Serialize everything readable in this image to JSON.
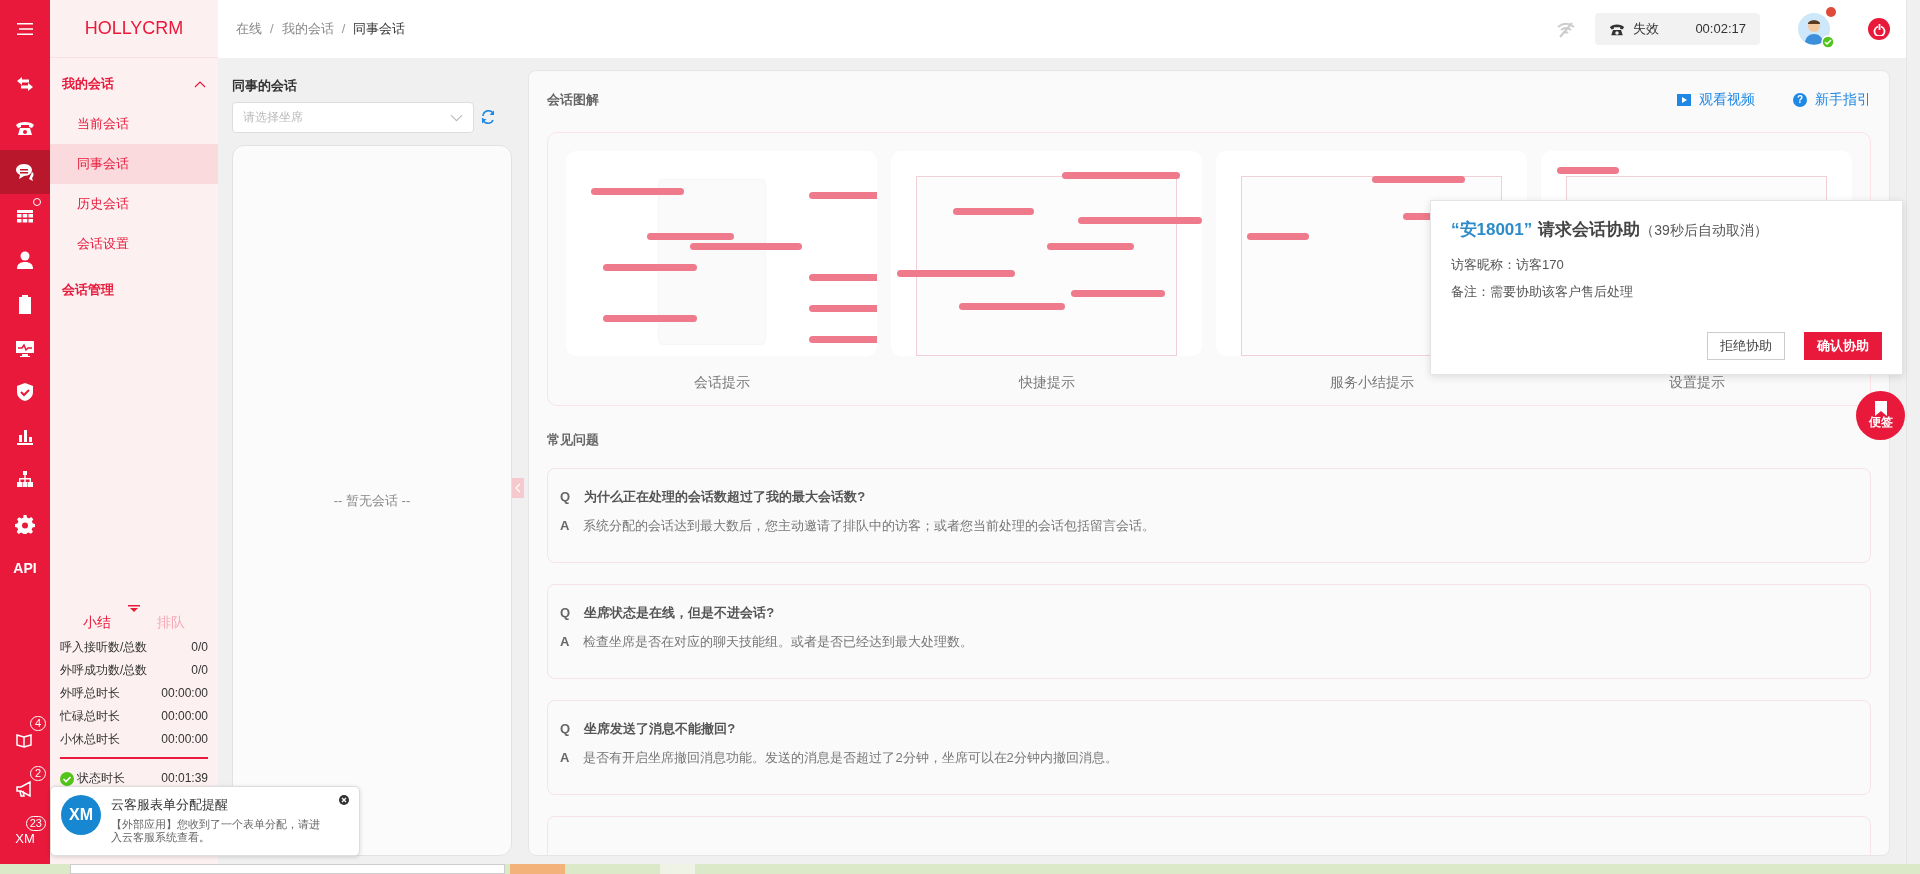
{
  "rail_items": [
    {
      "selected": false,
      "dot": false
    },
    {
      "selected": false,
      "dot": false
    },
    {
      "selected": true,
      "dot": false
    },
    {
      "selected": false,
      "dot": true
    },
    {
      "selected": false,
      "dot": false
    },
    {
      "selected": false,
      "dot": false
    },
    {
      "selected": false,
      "dot": false
    },
    {
      "selected": false,
      "dot": false
    },
    {
      "selected": false,
      "dot": false
    },
    {
      "selected": false,
      "dot": false
    },
    {
      "selected": false,
      "dot": false
    },
    {
      "selected": false,
      "dot": false,
      "label": "API"
    }
  ],
  "rail_bottom": [
    {
      "badge": "4"
    },
    {
      "badge": "2"
    },
    {
      "label": "XM",
      "badge": "23"
    }
  ],
  "brand": "HOLLYCRM",
  "nav": [
    {
      "label": "我的会话",
      "expanded": true,
      "children": [
        {
          "label": "当前会话",
          "selected": false
        },
        {
          "label": "同事会话",
          "selected": true
        },
        {
          "label": "历史会话",
          "selected": false
        },
        {
          "label": "会话设置",
          "selected": false
        }
      ]
    },
    {
      "label": "会话管理"
    }
  ],
  "stats": {
    "tabs": [
      {
        "label": "小结",
        "selected": true
      },
      {
        "label": "排队",
        "selected": false
      }
    ],
    "rows": [
      {
        "label": "呼入接听数/总数",
        "value": "0/0"
      },
      {
        "label": "外呼成功数/总数",
        "value": "0/0"
      },
      {
        "label": "外呼总时长",
        "value": "00:00:00"
      },
      {
        "label": "忙碌总时长",
        "value": "00:00:00"
      },
      {
        "label": "小休总时长",
        "value": "00:00:00"
      }
    ],
    "status": {
      "label": "状态时长",
      "value": "00:01:39"
    }
  },
  "breadcrumb": [
    {
      "kind": "link",
      "text": "在线"
    },
    {
      "kind": "separator",
      "text": "/"
    },
    {
      "kind": "link",
      "text": "我的会话"
    },
    {
      "kind": "separator",
      "text": "/"
    },
    {
      "kind": "current",
      "text": "同事会话"
    }
  ],
  "phone_status": {
    "label": "失效",
    "timer": "00:02:17"
  },
  "user": {
    "online": true,
    "unread_dot": true
  },
  "colleague": {
    "title": "同事的会话",
    "select_placeholder": "请选择坐席",
    "empty_text": "-- 暂无会话 --"
  },
  "guide": {
    "title": "会话图解",
    "links": [
      {
        "label": "观看视频"
      },
      {
        "label": "新手指引",
        "icon_text": "?"
      }
    ],
    "thumbnails": [
      "会话提示",
      "快捷提示",
      "服务小结提示",
      "设置提示"
    ]
  },
  "faq": {
    "title": "常见问题",
    "items": [
      {
        "q_label": "Q",
        "question": "为什么正在处理的会话数超过了我的最大会话数?",
        "a_label": "A",
        "answer": "系统分配的会话达到最大数后，您主动邀请了排队中的访客；或者您当前处理的会话包括留言会话。"
      },
      {
        "q_label": "Q",
        "question": "坐席状态是在线，但是不进会话?",
        "a_label": "A",
        "answer": "检查坐席是否在对应的聊天技能组。或者是否已经达到最大处理数。"
      },
      {
        "q_label": "Q",
        "question": "坐席发送了消息不能撤回?",
        "a_label": "A",
        "answer": "是否有开启坐席撤回消息功能。发送的消息是否超过了2分钟，坐席可以在2分钟内撤回消息。"
      }
    ]
  },
  "assist_popup": {
    "requester": "“安18001”",
    "title": "请求会话协助",
    "countdown": "（39秒后自动取消）",
    "lines": [
      "访客昵称：访客170",
      "备注：需要协助该客户售后处理"
    ],
    "buttons": [
      {
        "label": "拒绝协助",
        "kind": "secondary"
      },
      {
        "label": "确认协助",
        "kind": "primary"
      }
    ]
  },
  "notes_button": "便签",
  "toast": {
    "logo_text": "XM",
    "title": "云客服表单分配提醒",
    "message": "【外部应用】您收到了一个表单分配，请进入云客服系统查看。"
  }
}
